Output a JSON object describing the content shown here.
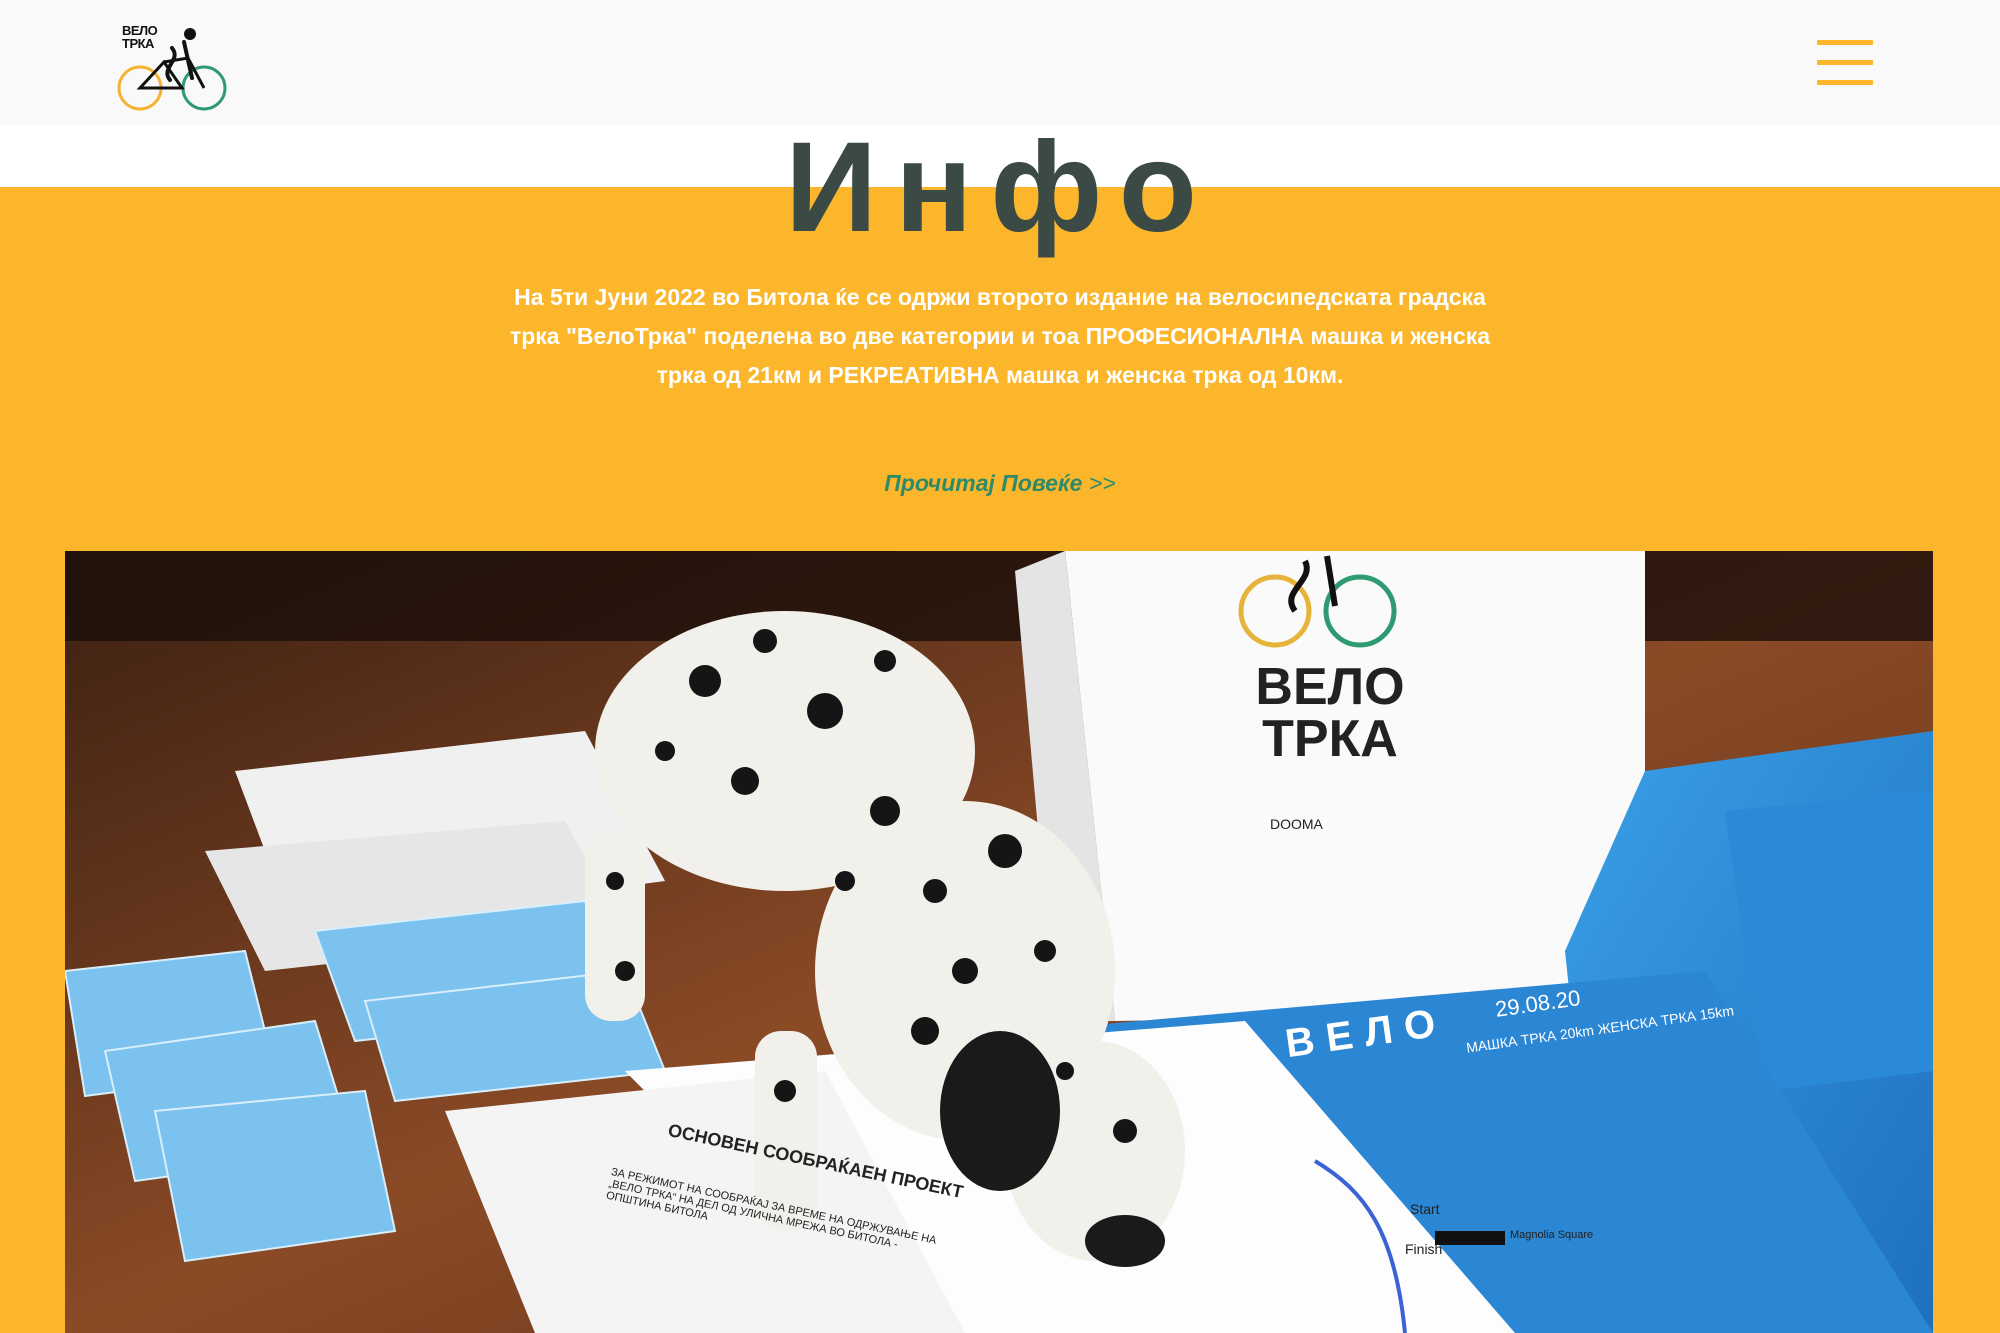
{
  "header": {
    "logo_text": "ВЕЛО\nТРКА",
    "logo_icon": "bicycle-logo-icon",
    "menu_icon": "hamburger-menu-icon",
    "colors": {
      "background": "#f9f9f9",
      "accent": "#fbb62b"
    }
  },
  "main": {
    "title": "Инфо",
    "intro_text": "На 5ти Јуни 2022 во Битола ќе се одржи второто издание на велосипедската градска трка \"ВелоТрка\" поделена во две категории и тоа ПРОФЕСИОНАЛНА машка и женска трка од 21км и РЕКРЕАТИВНА машка и женска трка од 10км.",
    "read_more_label": "Прочитај Повеќе",
    "read_more_arrows": ">>",
    "colors": {
      "background": "#fbb62b",
      "title": "#3b4a44",
      "intro": "#ffffff",
      "link": "#2f8a6a"
    }
  },
  "photo": {
    "bag_text": "ВЕЛО\nТРКА",
    "bag_sponsor_left": "DOOMA",
    "poster_text": "ВЕЛО",
    "poster_date": "29.08.20",
    "poster_sub": "МАШКА ТРКА 20km ЖЕНСКА ТРКА 15km",
    "map_title": "ОСНОВЕН СООБРАЌАЕН ПРОЕКТ",
    "map_subtitle": "ЗА РЕЖИМОТ НА СООБРАЌАЈ ЗА ВРЕМЕ НА ОДРЖУВАЊЕ НА „ВЕЛО ТРКА“ НА ДЕЛ ОД УЛИЧНА МРЕЖА ВО БИТОЛА - ОПШТИНА БИТОЛА",
    "map_start": "Start",
    "map_finish": "Finish",
    "map_square": "Magnolia Square"
  }
}
